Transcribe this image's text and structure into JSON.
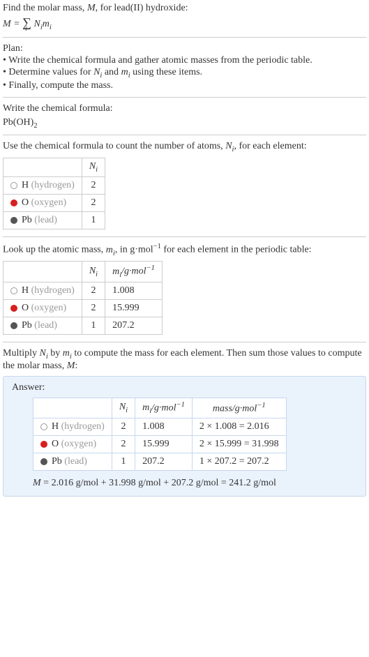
{
  "intro": {
    "line1_prefix": "Find the molar mass, ",
    "line1_m": "M",
    "line1_suffix": ", for lead(II) hydroxide:",
    "formula": "M = ∑ Nᵢmᵢ",
    "formula_sub": "i"
  },
  "plan": {
    "header": "Plan:",
    "bullet1": "• Write the chemical formula and gather atomic masses from the periodic table.",
    "bullet2_prefix": "• Determine values for ",
    "bullet2_ni": "Nᵢ",
    "bullet2_mid": " and ",
    "bullet2_mi": "mᵢ",
    "bullet2_suffix": " using these items.",
    "bullet3": "• Finally, compute the mass."
  },
  "chem": {
    "header": "Write the chemical formula:",
    "formula_base": "Pb(OH)",
    "formula_sub": "2"
  },
  "count": {
    "header_prefix": "Use the chemical formula to count the number of atoms, ",
    "header_ni": "Nᵢ",
    "header_suffix": ", for each element:",
    "col_ni": "Nᵢ",
    "rows": [
      {
        "dot": "dot-h",
        "sym": "H",
        "name": "(hydrogen)",
        "n": "2"
      },
      {
        "dot": "dot-o",
        "sym": "O",
        "name": "(oxygen)",
        "n": "2"
      },
      {
        "dot": "dot-pb",
        "sym": "Pb",
        "name": "(lead)",
        "n": "1"
      }
    ]
  },
  "mass": {
    "header_prefix": "Look up the atomic mass, ",
    "header_mi": "mᵢ",
    "header_mid": ", in g·mol",
    "header_exp": "−1",
    "header_suffix": " for each element in the periodic table:",
    "col_ni": "Nᵢ",
    "col_mi_prefix": "mᵢ",
    "col_mi_mid": "/g·mol",
    "col_mi_exp": "−1",
    "rows": [
      {
        "dot": "dot-h",
        "sym": "H",
        "name": "(hydrogen)",
        "n": "2",
        "m": "1.008"
      },
      {
        "dot": "dot-o",
        "sym": "O",
        "name": "(oxygen)",
        "n": "2",
        "m": "15.999"
      },
      {
        "dot": "dot-pb",
        "sym": "Pb",
        "name": "(lead)",
        "n": "1",
        "m": "207.2"
      }
    ]
  },
  "multiply": {
    "text_prefix": "Multiply ",
    "ni": "Nᵢ",
    "text_mid1": " by ",
    "mi": "mᵢ",
    "text_mid2": " to compute the mass for each element. Then sum those values to compute the molar mass, ",
    "m": "M",
    "text_suffix": ":"
  },
  "answer": {
    "label": "Answer:",
    "col_ni": "Nᵢ",
    "col_mi_prefix": "mᵢ",
    "col_mi_mid": "/g·mol",
    "col_mi_exp": "−1",
    "col_mass_prefix": "mass/g·mol",
    "col_mass_exp": "−1",
    "rows": [
      {
        "dot": "dot-h",
        "sym": "H",
        "name": "(hydrogen)",
        "n": "2",
        "m": "1.008",
        "calc": "2 × 1.008 = 2.016"
      },
      {
        "dot": "dot-o",
        "sym": "O",
        "name": "(oxygen)",
        "n": "2",
        "m": "15.999",
        "calc": "2 × 15.999 = 31.998"
      },
      {
        "dot": "dot-pb",
        "sym": "Pb",
        "name": "(lead)",
        "n": "1",
        "m": "207.2",
        "calc": "1 × 207.2 = 207.2"
      }
    ],
    "final_m": "M",
    "final_text": " = 2.016 g/mol + 31.998 g/mol + 207.2 g/mol = 241.2 g/mol"
  }
}
